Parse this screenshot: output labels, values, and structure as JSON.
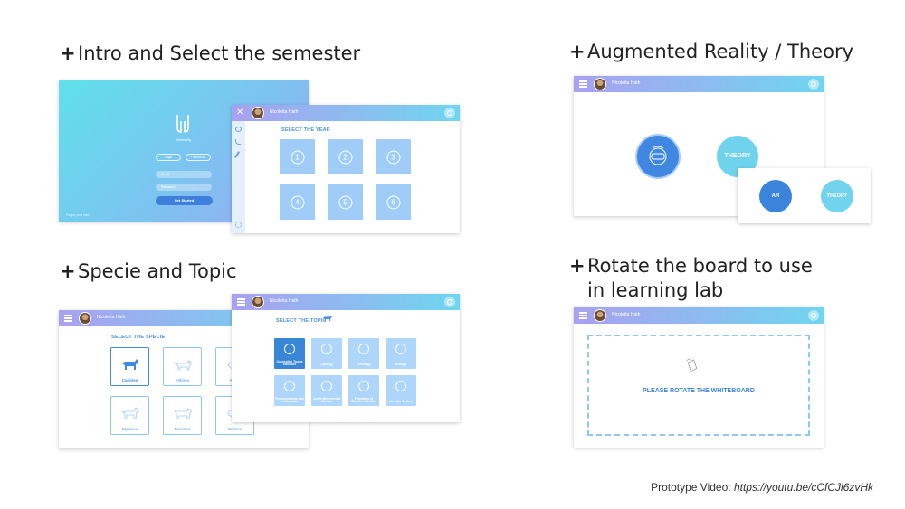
{
  "headings": {
    "intro": "Intro and Select the semester",
    "specie": "Specie and Topic",
    "ar": "Augmented Reality / Theory",
    "rotate_line1": "Rotate the board to use",
    "rotate_line2": "in learning lab",
    "plus": "+"
  },
  "app": {
    "logo_text": "Vetreality",
    "user_name": "Nicoletta Hath"
  },
  "login": {
    "tab_login": "Login",
    "tab_facebook": "Facebook",
    "email_placeholder": "Email",
    "password_placeholder": "Password",
    "get_started": "Get Started",
    "footer_left": "Forgot your info?"
  },
  "year_screen": {
    "title": "SELECT THE YEAR",
    "years": [
      "1",
      "2",
      "3",
      "4",
      "5",
      "6"
    ]
  },
  "specie_screen": {
    "title": "SELECT THE SPECIE",
    "species": [
      "Canines",
      "Felines",
      "Avian",
      "Equines",
      "Bovines",
      "Swines"
    ]
  },
  "topic_screen": {
    "title": "SELECT THE TOPIC",
    "topics": [
      "Connective Tissue Structure",
      "Cytology",
      "Histology",
      "Biology",
      "Photosynthesis and Locomotion",
      "Joints Movement & Cavities",
      "Formation of Skeleton Cavities",
      "Nervous System"
    ]
  },
  "ar_screen": {
    "theory_label": "THEORY",
    "ar_label": "AR"
  },
  "rotate_screen": {
    "message": "PLEASE ROTATE THE WHITEBOARD"
  },
  "footer": {
    "label": "Prototype Video: ",
    "url": "https://youtu.be/cCfCJl6zvHk"
  },
  "colors": {
    "accent_blue": "#4a90e2",
    "tile_blue": "#9fcdf8",
    "cyan": "#6fd6ee",
    "purple": "#a9a1f0"
  }
}
